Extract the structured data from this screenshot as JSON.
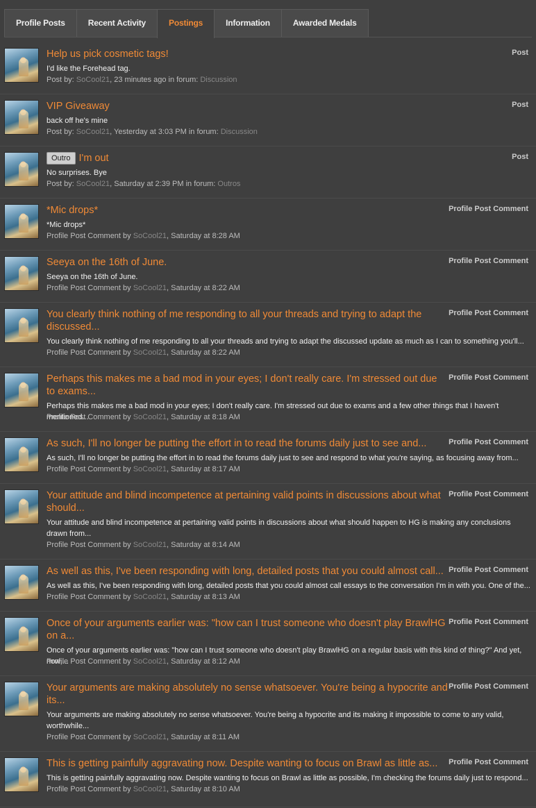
{
  "tabs": [
    "Profile Posts",
    "Recent Activity",
    "Postings",
    "Information",
    "Awarded Medals"
  ],
  "items": [
    {
      "title": "Help us pick cosmetic tags!",
      "kind": "Post",
      "snippet": "I'd like the Forehead tag.",
      "prefix": "Post by: ",
      "user": "SoCool21",
      "time": ", 23 minutes ago in forum: ",
      "forum": "Discussion"
    },
    {
      "title": "VIP Giveaway",
      "kind": "Post",
      "snippet": "back off he's mine",
      "prefix": "Post by: ",
      "user": "SoCool21",
      "time": ", Yesterday at 3:03 PM in forum: ",
      "forum": "Discussion"
    },
    {
      "badge": "Outro",
      "title": "I'm out",
      "kind": "Post",
      "snippet": "No surprises. Bye",
      "prefix": "Post by: ",
      "user": "SoCool21",
      "time": ", Saturday at 2:39 PM in forum: ",
      "forum": "Outros"
    },
    {
      "title": "*Mic drops*",
      "kind": "Profile Post Comment",
      "snippet": "*Mic drops*",
      "prefix": "Profile Post Comment by ",
      "user": "SoCool21",
      "time": ", Saturday at 8:28 AM"
    },
    {
      "title": "Seeya on the 16th of June.",
      "kind": "Profile Post Comment",
      "snippet": "Seeya on the 16th of June.",
      "prefix": "Profile Post Comment by ",
      "user": "SoCool21",
      "time": ", Saturday at 8:22 AM"
    },
    {
      "title": "You clearly think nothing of me responding to all your threads and trying to adapt the discussed...",
      "kind": "Profile Post Comment",
      "snippet": "You clearly think nothing of me responding to all your threads and trying to adapt the discussed update as much as I can to something you'll...",
      "prefix": "Profile Post Comment by ",
      "user": "SoCool21",
      "time": ", Saturday at 8:22 AM"
    },
    {
      "title": "Perhaps this makes me a bad mod in your eyes; I don't really care. I'm stressed out due to exams...",
      "kind": "Profile Post Comment",
      "snippet": "Perhaps this makes me a bad mod in your eyes; I don't really care. I'm stressed out due to exams and a few other things that I haven't mentioned...",
      "prefix": "Profile Post Comment by ",
      "user": "SoCool21",
      "time": ", Saturday at 8:18 AM"
    },
    {
      "title": "As such, I'll no longer be putting the effort in to read the forums daily just to see and...",
      "kind": "Profile Post Comment",
      "snippet": "As such, I'll no longer be putting the effort in to read the forums daily just to see and respond to what you're saying, as focusing away from...",
      "prefix": "Profile Post Comment by ",
      "user": "SoCool21",
      "time": ", Saturday at 8:17 AM"
    },
    {
      "title": "Your attitude and blind incompetence at pertaining valid points in discussions about what should...",
      "kind": "Profile Post Comment",
      "snippet": "Your attitude and blind incompetence at pertaining valid points in discussions about what should happen to HG is making any conclusions drawn from...",
      "prefix": "Profile Post Comment by ",
      "user": "SoCool21",
      "time": ", Saturday at 8:14 AM"
    },
    {
      "title": "As well as this, I've been responding with long, detailed posts that you could almost call...",
      "kind": "Profile Post Comment",
      "snippet": "As well as this, I've been responding with long, detailed posts that you could almost call essays to the conversation I'm in with you. One of the...",
      "prefix": "Profile Post Comment by ",
      "user": "SoCool21",
      "time": ", Saturday at 8:13 AM"
    },
    {
      "title": "Once of your arguments earlier was: \"how can I trust someone who doesn't play BrawlHG on a...",
      "kind": "Profile Post Comment",
      "snippet": "Once of your arguments earlier was: \"how can I trust someone who doesn't play BrawlHG on a regular basis with this kind of thing?\" And yet, now,...",
      "prefix": "Profile Post Comment by ",
      "user": "SoCool21",
      "time": ", Saturday at 8:12 AM"
    },
    {
      "title": "Your arguments are making absolutely no sense whatsoever. You're being a hypocrite and its...",
      "kind": "Profile Post Comment",
      "snippet": "Your arguments are making absolutely no sense whatsoever. You're being a hypocrite and its making it impossible to come to any valid, worthwhile...",
      "prefix": "Profile Post Comment by ",
      "user": "SoCool21",
      "time": ", Saturday at 8:11 AM"
    },
    {
      "title": "This is getting painfully aggravating now. Despite wanting to focus on Brawl as little as...",
      "kind": "Profile Post Comment",
      "snippet": "This is getting painfully aggravating now. Despite wanting to focus on Brawl as little as possible, I'm checking the forums daily just to respond...",
      "prefix": "Profile Post Comment by ",
      "user": "SoCool21",
      "time": ", Saturday at 8:10 AM"
    }
  ]
}
